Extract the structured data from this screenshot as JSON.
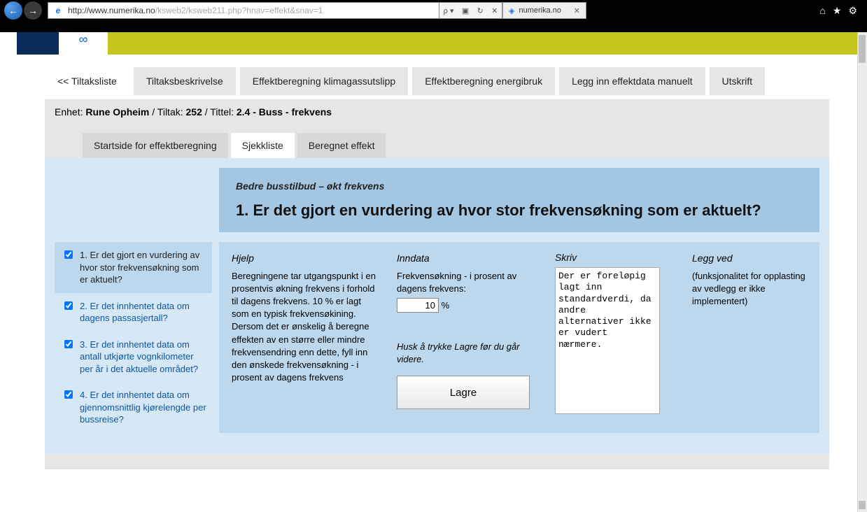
{
  "browser": {
    "url_host": "http://www.numerika.no",
    "url_path": "/ksweb2/ksweb211.php?hnav=effekt&snav=1",
    "search_hint": "ρ",
    "tab_title": "numerika.no",
    "tools": [
      "⟳",
      "✕"
    ]
  },
  "main_tabs": {
    "back": "<< Tiltaksliste",
    "t1": "Tiltaksbeskrivelse",
    "t2": "Effektberegning klimagassutslipp",
    "t3": "Effektberegning energibruk",
    "t4": "Legg inn effektdata manuelt",
    "t5": "Utskrift"
  },
  "unit": {
    "l_enhet": "Enhet: ",
    "v_enhet": "Rune Opheim",
    "sep1": " / Tiltak: ",
    "v_tiltak": "252",
    "sep2": " / Tittel: ",
    "v_tittel": "2.4 - Buss - frekvens"
  },
  "sub_tabs": {
    "s1": "Startside for effektberegning",
    "s2": "Sjekkliste",
    "s3": "Beregnet effekt"
  },
  "qheader": {
    "sub": "Bedre busstilbud – økt frekvens",
    "title": "1. Er det gjort en vurdering av hvor stor frekvensøkning som er aktuelt?"
  },
  "checklist": {
    "i1": "1. Er det gjort en vurdering av hvor stor frekvensøkning som er aktuelt?",
    "i2": "2. Er det innhentet data om dagens passasjertall?",
    "i3": "3. Er det innhentet data om antall utkjørte vognkilometer per år i det aktuelle området?",
    "i4": "4. Er det innhentet data om gjennomsnittlig kjørelengde per bussreise?"
  },
  "help": {
    "h": "Hjelp",
    "text": "Beregningene tar utgangspunkt i en prosentvis økning frekvens i forhold til dagens frekvens. 10 % er lagt som en typisk frekvensøkining. Dersom det er ønskelig å beregne effekten av en større eller mindre frekvensendring enn dette, fyll inn den ønskede frekvensøkning - i prosent av dagens frekvens"
  },
  "inndata": {
    "h": "Inndata",
    "label": "Frekvensøkning - i prosent av dagens frekvens:",
    "value": "10",
    "unit": "%",
    "hint": "Husk å trykke Lagre før du går videre.",
    "save": "Lagre"
  },
  "skriv": {
    "h": "Skriv",
    "value": "Der er foreløpig lagt inn standardverdi, da andre alternativer ikke er vudert nærmere."
  },
  "attach": {
    "h": "Legg ved",
    "text": "(funksjonalitet for opplasting av vedlegg er ikke implementert)"
  }
}
